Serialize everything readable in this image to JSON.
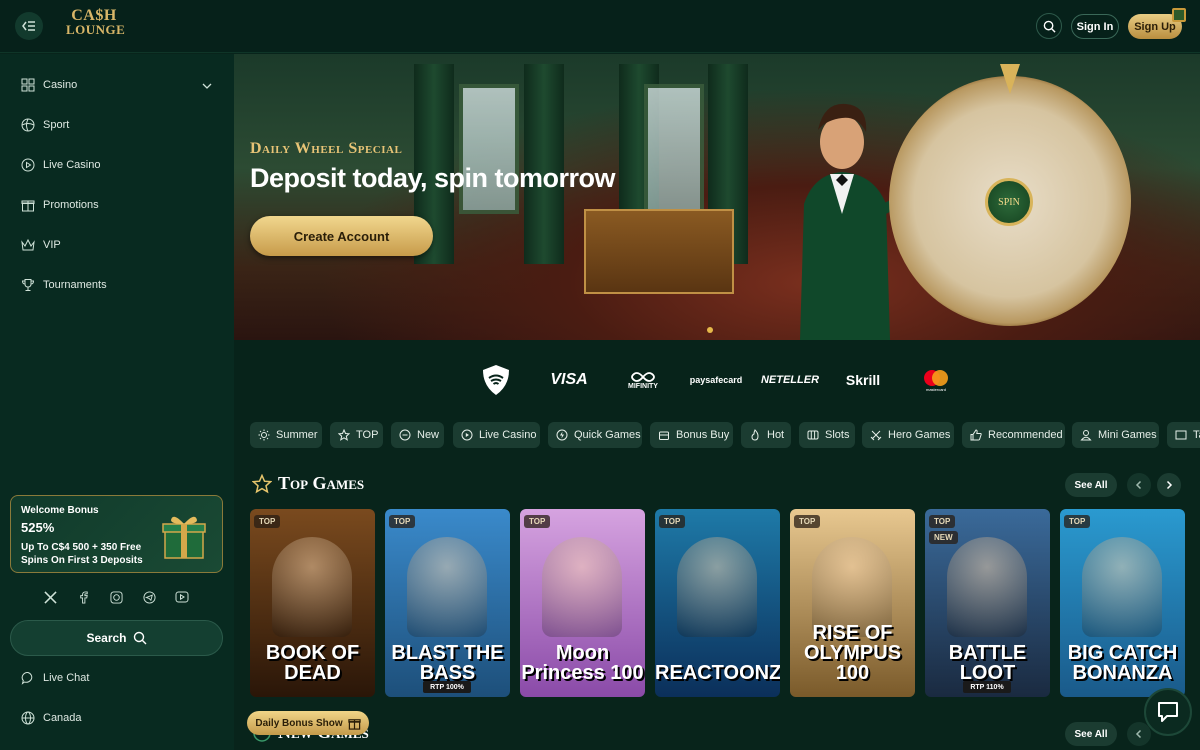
{
  "brand": {
    "line1": "CA$H",
    "line2": "LOUNGE"
  },
  "header": {
    "signin_label": "Sign In",
    "signup_label": "Sign Up"
  },
  "sidebar": {
    "items": [
      {
        "label": "Casino",
        "icon": "grid-icon"
      },
      {
        "label": "Sport",
        "icon": "ball-icon"
      },
      {
        "label": "Live Casino",
        "icon": "play-circle-icon"
      },
      {
        "label": "Promotions",
        "icon": "gift-icon"
      },
      {
        "label": "VIP",
        "icon": "crown-icon"
      },
      {
        "label": "Tournaments",
        "icon": "trophy-icon"
      }
    ],
    "bonus": {
      "title": "Welcome Bonus",
      "percent": "525%",
      "detail": "Up To C$4 500 + 350 Free Spins On First 3 Deposits"
    },
    "social": [
      "x-icon",
      "facebook-icon",
      "instagram-icon",
      "telegram-icon",
      "youtube-icon"
    ],
    "search_label": "Search",
    "live_chat_label": "Live Chat",
    "region_label": "Canada"
  },
  "hero": {
    "kicker": "Daily Wheel Special",
    "headline": "Deposit today, spin tomorrow",
    "cta": "Create Account",
    "wheel_label": "SPIN"
  },
  "payments": [
    "VISA",
    "MIFINITY",
    "paysafecard",
    "NETELLER",
    "Skrill",
    "mastercard"
  ],
  "chips": [
    {
      "label": "Summer",
      "icon": "sun-icon"
    },
    {
      "label": "TOP",
      "icon": "star-icon"
    },
    {
      "label": "New",
      "icon": "new-icon"
    },
    {
      "label": "Live Casino",
      "icon": "play-circle-icon"
    },
    {
      "label": "Quick Games",
      "icon": "bolt-icon"
    },
    {
      "label": "Bonus Buy",
      "icon": "cart-icon"
    },
    {
      "label": "Hot",
      "icon": "flame-icon"
    },
    {
      "label": "Slots",
      "icon": "slots-icon"
    },
    {
      "label": "Hero Games",
      "icon": "sword-icon"
    },
    {
      "label": "Recommended",
      "icon": "thumbs-up-icon"
    },
    {
      "label": "Mini Games",
      "icon": "user-icon"
    },
    {
      "label": "Ta",
      "icon": "table-icon"
    }
  ],
  "top_games": {
    "title": "Top Games",
    "see_all": "See All",
    "games": [
      {
        "title": "BOOK OF DEAD",
        "badges": [
          "TOP"
        ],
        "rtp": "",
        "color1": "#7a4a1e",
        "color2": "#2a1608"
      },
      {
        "title": "BLAST THE BASS",
        "badges": [
          "TOP"
        ],
        "rtp": "RTP 100%",
        "color1": "#3a8acb",
        "color2": "#1d4f7a"
      },
      {
        "title": "Moon Princess 100",
        "badges": [
          "TOP"
        ],
        "rtp": "",
        "color1": "#d6a3e0",
        "color2": "#8a4aa8"
      },
      {
        "title": "REACTOONZ",
        "badges": [
          "TOP"
        ],
        "rtp": "",
        "color1": "#1e7aa8",
        "color2": "#0b2f5a"
      },
      {
        "title": "RISE OF OLYMPUS 100",
        "badges": [
          "TOP"
        ],
        "rtp": "",
        "color1": "#e8c890",
        "color2": "#7a5a2a"
      },
      {
        "title": "BATTLE LOOT",
        "badges": [
          "TOP",
          "NEW"
        ],
        "rtp": "RTP 110%",
        "color1": "#3a6a9a",
        "color2": "#1a2a40"
      },
      {
        "title": "BIG CATCH BONANZA",
        "badges": [
          "TOP"
        ],
        "rtp": "",
        "color1": "#2a9ad0",
        "color2": "#1a5a8a"
      }
    ]
  },
  "new_games": {
    "title": "New Games",
    "see_all": "See All"
  },
  "daily_bonus": {
    "label": "Daily Bonus Show"
  }
}
